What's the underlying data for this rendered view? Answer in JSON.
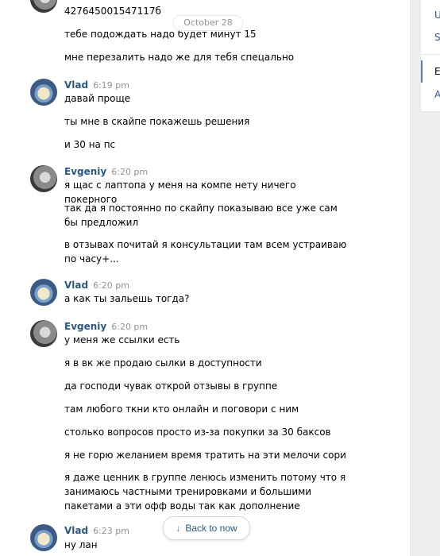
{
  "date_separator": "October 28",
  "back_to_now": "Back to now",
  "right_panel": {
    "items": [
      "U",
      "S",
      "E",
      "A"
    ]
  },
  "messages": [
    {
      "sender": "",
      "time": "",
      "avatar": "evgeniy",
      "lines": [
        "427645001547117б",
        "тебе подождать надо будет минут 15",
        "мне перезалить надо же для тебя спецально"
      ]
    },
    {
      "sender": "Vlad",
      "time": "6:19 pm",
      "avatar": "vlad",
      "lines": [
        "давай проще",
        "ты мне в скайпе покажешь решения",
        "и 30 на пс"
      ]
    },
    {
      "sender": "Evgeniy",
      "time": "6:20 pm",
      "avatar": "evgeniy",
      "lines": [
        "я щас с лаптопа у меня на компе нету ничего покерного",
        "так да я постоянно по скайпу показываю все уже сам бы предложил",
        "в отзывах почитай я консультации там всем устраиваю по часу+..."
      ]
    },
    {
      "sender": "Vlad",
      "time": "6:20 pm",
      "avatar": "vlad",
      "lines": [
        "а как ты зальешь тогда?"
      ]
    },
    {
      "sender": "Evgeniy",
      "time": "6:20 pm",
      "avatar": "evgeniy",
      "lines": [
        "у меня же ссылки есть",
        "я в вк же продаю сылки в доступности",
        "да господи чувак открой отзывы в группе",
        "там любого ткни кто онлайн и поговори с ним",
        "столько вопросов просто из-за покупки за 30 баксов",
        "я не горю желанием время тратить на эти мелочи сори",
        "я даже ценник в группе ленюсь изменить потому что я занимаюсь частными тренировками и большими пакетами а эти офф воды так как дополнение"
      ]
    },
    {
      "sender": "Vlad",
      "time": "6:23 pm",
      "avatar": "vlad",
      "lines": [
        "ну лан"
      ]
    }
  ]
}
